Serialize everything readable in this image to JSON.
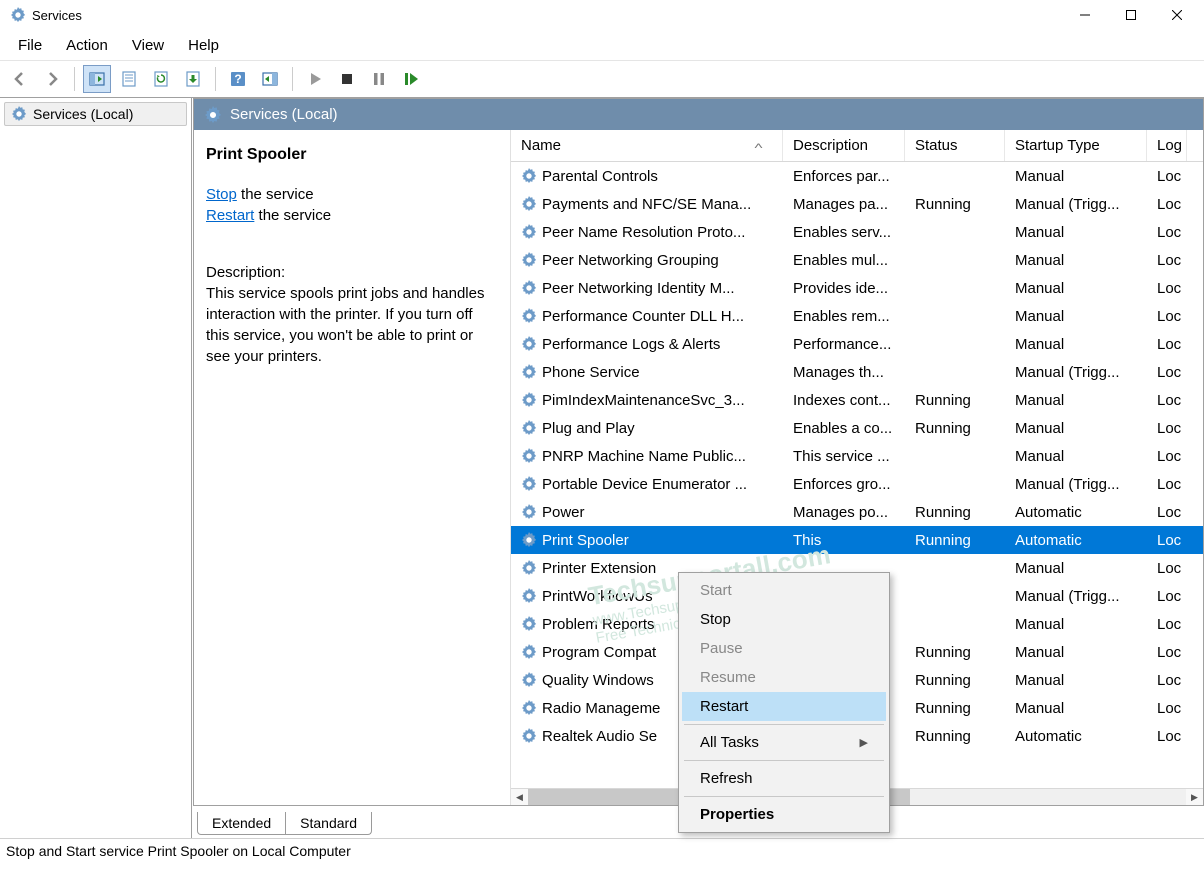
{
  "window": {
    "title": "Services"
  },
  "menu": {
    "items": [
      "File",
      "Action",
      "View",
      "Help"
    ]
  },
  "tree": {
    "root": "Services (Local)"
  },
  "panel_header": "Services (Local)",
  "details": {
    "selected_name": "Print Spooler",
    "stop_link": "Stop",
    "stop_suffix": " the service",
    "restart_link": "Restart",
    "restart_suffix": " the service",
    "desc_label": "Description:",
    "desc_text": "This service spools print jobs and handles interaction with the printer. If you turn off this service, you won't be able to print or see your printers."
  },
  "columns": {
    "name": "Name",
    "desc": "Description",
    "status": "Status",
    "startup": "Startup Type",
    "logon": "Log On As"
  },
  "rows": [
    {
      "name": "Parental Controls",
      "desc": "Enforces par...",
      "status": "",
      "startup": "Manual",
      "logon": "Loc"
    },
    {
      "name": "Payments and NFC/SE Mana...",
      "desc": "Manages pa...",
      "status": "Running",
      "startup": "Manual (Trigg...",
      "logon": "Loc"
    },
    {
      "name": "Peer Name Resolution Proto...",
      "desc": "Enables serv...",
      "status": "",
      "startup": "Manual",
      "logon": "Loc"
    },
    {
      "name": "Peer Networking Grouping",
      "desc": "Enables mul...",
      "status": "",
      "startup": "Manual",
      "logon": "Loc"
    },
    {
      "name": "Peer Networking Identity M...",
      "desc": "Provides ide...",
      "status": "",
      "startup": "Manual",
      "logon": "Loc"
    },
    {
      "name": "Performance Counter DLL H...",
      "desc": "Enables rem...",
      "status": "",
      "startup": "Manual",
      "logon": "Loc"
    },
    {
      "name": "Performance Logs & Alerts",
      "desc": "Performance...",
      "status": "",
      "startup": "Manual",
      "logon": "Loc"
    },
    {
      "name": "Phone Service",
      "desc": "Manages th...",
      "status": "",
      "startup": "Manual (Trigg...",
      "logon": "Loc"
    },
    {
      "name": "PimIndexMaintenanceSvc_3...",
      "desc": "Indexes cont...",
      "status": "Running",
      "startup": "Manual",
      "logon": "Loc"
    },
    {
      "name": "Plug and Play",
      "desc": "Enables a co...",
      "status": "Running",
      "startup": "Manual",
      "logon": "Loc"
    },
    {
      "name": "PNRP Machine Name Public...",
      "desc": "This service ...",
      "status": "",
      "startup": "Manual",
      "logon": "Loc"
    },
    {
      "name": "Portable Device Enumerator ...",
      "desc": "Enforces gro...",
      "status": "",
      "startup": "Manual (Trigg...",
      "logon": "Loc"
    },
    {
      "name": "Power",
      "desc": "Manages po...",
      "status": "Running",
      "startup": "Automatic",
      "logon": "Loc"
    },
    {
      "name": "Print Spooler",
      "desc": "This",
      "status": "Running",
      "startup": "Automatic",
      "logon": "Loc",
      "selected": true
    },
    {
      "name": "Printer Extension",
      "desc": "",
      "status": "",
      "startup": "Manual",
      "logon": "Loc"
    },
    {
      "name": "PrintWorkflowUs",
      "desc": "",
      "status": "",
      "startup": "Manual (Trigg...",
      "logon": "Loc"
    },
    {
      "name": "Problem Reports",
      "desc": "",
      "status": "",
      "startup": "Manual",
      "logon": "Loc"
    },
    {
      "name": "Program Compat",
      "desc": "",
      "status": "Running",
      "startup": "Manual",
      "logon": "Loc"
    },
    {
      "name": "Quality Windows",
      "desc": "",
      "status": "Running",
      "startup": "Manual",
      "logon": "Loc"
    },
    {
      "name": "Radio Manageme",
      "desc": "",
      "status": "Running",
      "startup": "Manual",
      "logon": "Loc"
    },
    {
      "name": "Realtek Audio Se",
      "desc": "",
      "status": "Running",
      "startup": "Automatic",
      "logon": "Loc"
    }
  ],
  "context_menu": {
    "start": "Start",
    "stop": "Stop",
    "pause": "Pause",
    "resume": "Resume",
    "restart": "Restart",
    "all_tasks": "All Tasks",
    "refresh": "Refresh",
    "properties": "Properties"
  },
  "tabs": {
    "extended": "Extended",
    "standard": "Standard"
  },
  "statusbar": "Stop and Start service Print Spooler on Local Computer",
  "watermark": {
    "line1": "Techsupportall.com",
    "line2": "www.Techsupportall.com",
    "line3": "Free Technical Help center"
  }
}
